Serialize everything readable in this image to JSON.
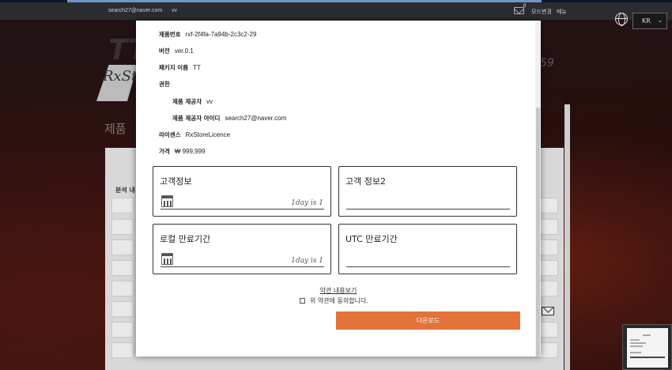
{
  "topbar": {
    "email": "search27@naver.com",
    "user": "vv",
    "mail_count": "0",
    "mode_change": "모드변경",
    "menu": "메뉴",
    "language": "KR"
  },
  "background": {
    "logo_text": "TT",
    "logo_script": "RxSt",
    "timer_fragment": "59",
    "heading": "제품",
    "panel_label": "분석 내"
  },
  "modal": {
    "info": [
      {
        "key": "제품번호",
        "value": "rxf-2f4fa-7a94b-2c3c2-29"
      },
      {
        "key": "버전",
        "value": "ver.0.1"
      },
      {
        "key": "패키지 이름",
        "value": "TT"
      },
      {
        "key": "권한",
        "value": ""
      },
      {
        "key": "제품 제공자",
        "value": "vv"
      },
      {
        "key": "제품 제공자 아이디",
        "value": "search27@naver.com"
      },
      {
        "key": "라이센스",
        "value": "RxStoreLicence"
      },
      {
        "key": "가격",
        "value": "₩ 999,999"
      }
    ],
    "fields": {
      "customer_info": {
        "title": "고객정보",
        "hint": "1day is 1"
      },
      "customer_info2": {
        "title": "고객 정보2"
      },
      "local_expiry": {
        "title": "로컬 만료기간",
        "hint": "1day is 1"
      },
      "utc_expiry": {
        "title": "UTC 만료기간"
      }
    },
    "terms_link": "약관 내용보기",
    "agree_label": "위 약관에 동의합니다.",
    "download_label": "다운로드",
    "accent_color": "#e3733a"
  }
}
